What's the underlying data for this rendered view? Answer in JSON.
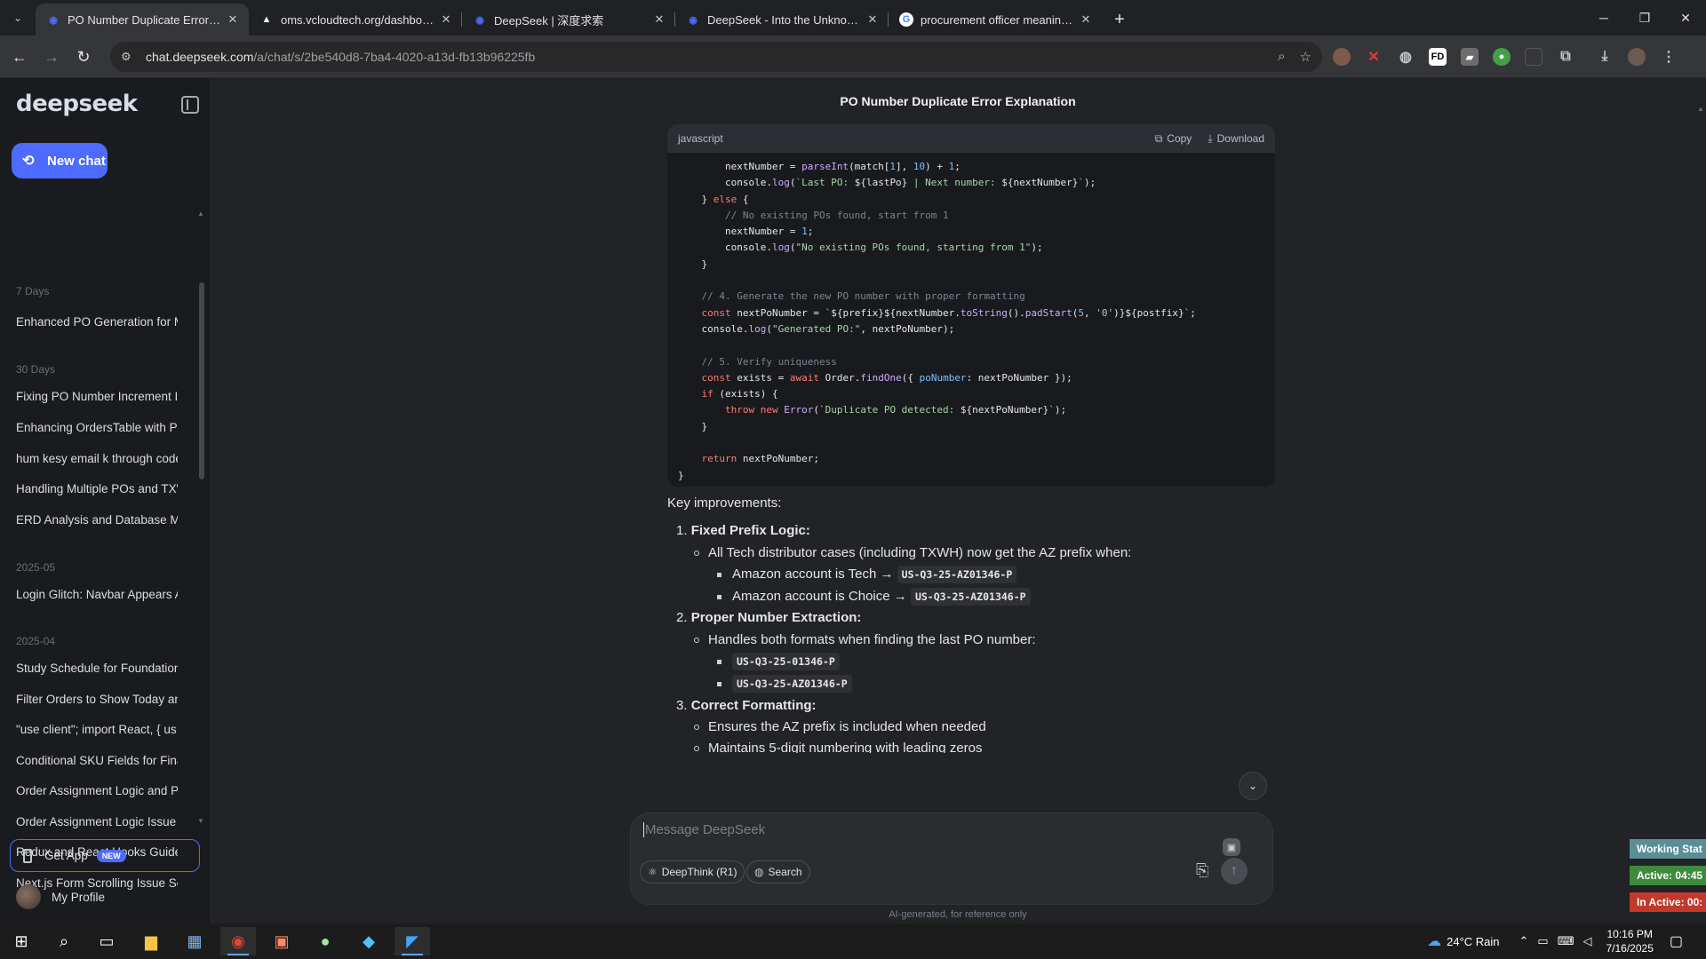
{
  "browser": {
    "tabs": [
      {
        "title": "PO Number Duplicate Error Exp",
        "favicon": "deepseek-icon",
        "active": true
      },
      {
        "title": "oms.vcloudtech.org/dashboard",
        "favicon": "vercel-icon",
        "active": false
      },
      {
        "title": "DeepSeek | 深度求索",
        "favicon": "deepseek-icon",
        "active": false
      },
      {
        "title": "DeepSeek - Into the Unknown",
        "favicon": "deepseek-icon",
        "active": false
      },
      {
        "title": "procurement officer meaning -",
        "favicon": "google-icon",
        "active": false
      }
    ],
    "url_domain": "chat.deepseek.com",
    "url_path": "/a/chat/s/2be540d8-7ba4-4020-a13d-fb13b96225fb",
    "extensions": [
      "FD"
    ]
  },
  "sidebar": {
    "logo": "deepseek",
    "new_chat": "New chat",
    "groups": [
      {
        "label": "7 Days",
        "items": [
          "Enhanced PO Generation for Mu"
        ]
      },
      {
        "label": "30 Days",
        "items": [
          "Fixing PO Number Increment Iss",
          "Enhancing OrdersTable with Pro",
          "hum kesy email k through code",
          "Handling Multiple POs and TXW",
          "ERD Analysis and Database Mod"
        ]
      },
      {
        "label": "2025-05",
        "items": [
          "Login Glitch: Navbar Appears Ab"
        ]
      },
      {
        "label": "2025-04",
        "items": [
          "Study Schedule for Foundation U",
          "Filter Orders to Show Today and",
          "\"use client\"; import React, { us",
          "Conditional SKU Fields for Finan",
          "Order Assignment Logic and Pri",
          "Order Assignment Logic Issue w",
          "Redux and React Hooks Guide w",
          "Next.js Form Scrolling Issue Solu"
        ]
      }
    ],
    "get_app": "Get App",
    "new_badge": "NEW",
    "profile": "My Profile"
  },
  "chat": {
    "title": "PO Number Duplicate Error Explanation",
    "code_lang": "javascript",
    "copy": "Copy",
    "download": "Download",
    "intro": "Key improvements:",
    "points": [
      {
        "num": "1.",
        "title": "Fixed Prefix Logic:",
        "sub": "All Tech distributor cases (including TXWH) now get the AZ prefix when:",
        "items": [
          {
            "text": "Amazon account is Tech → ",
            "code": "US-Q3-25-AZ01346-P"
          },
          {
            "text": "Amazon account is Choice → ",
            "code": "US-Q3-25-AZ01346-P"
          }
        ]
      },
      {
        "num": "2.",
        "title": "Proper Number Extraction:",
        "sub": "Handles both formats when finding the last PO number:",
        "items": [
          {
            "text": "",
            "code": "US-Q3-25-01346-P"
          },
          {
            "text": "",
            "code": "US-Q3-25-AZ01346-P"
          }
        ]
      },
      {
        "num": "3.",
        "title": "Correct Formatting:",
        "sub": "Ensures the AZ prefix is included when needed",
        "sub2": "Maintains 5-digit numbering with leading zeros"
      }
    ]
  },
  "composer": {
    "placeholder": "Message DeepSeek",
    "deepthink": "DeepThink (R1)",
    "search": "Search",
    "footnote": "AI-generated, for reference only"
  },
  "tracker": {
    "working": "Working Stat",
    "active": "Active: 04:45",
    "inactive": "In Active: 00:"
  },
  "taskbar": {
    "weather": "24°C  Rain",
    "time": "10:16 PM",
    "date": "7/16/2025"
  }
}
